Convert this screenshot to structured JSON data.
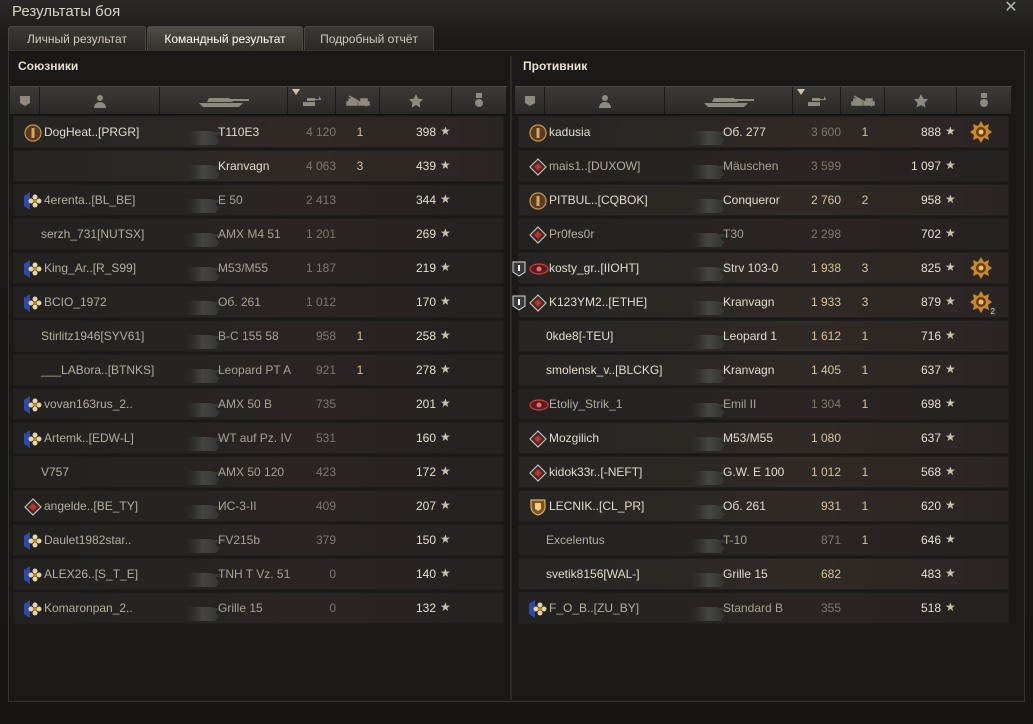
{
  "window": {
    "title": "Результаты боя",
    "close": "✕"
  },
  "tabs": [
    "Личный результат",
    "Командный результат",
    "Подробный отчёт"
  ],
  "active_tab": 1,
  "allies": {
    "title": "Союзники",
    "rows": [
      {
        "name": "DogHeat..[PRGR]",
        "tank": "T110E3",
        "damage": "4 120",
        "kills": "1",
        "xp": "398",
        "badge": "rank-gold",
        "alive": true,
        "dmg_hi": false
      },
      {
        "name": "",
        "tank": "Kranvagn",
        "damage": "4 063",
        "kills": "3",
        "xp": "439",
        "badge": "none",
        "alive": true,
        "dmg_hi": false
      },
      {
        "name": "4erenta..[BL_BE]",
        "tank": "E 50",
        "damage": "2 413",
        "kills": "",
        "xp": "344",
        "badge": "flower",
        "alive": false,
        "dmg_hi": false
      },
      {
        "name": "serzh_731[NUTSX]",
        "tank": "AMX M4 51",
        "damage": "1 201",
        "kills": "",
        "xp": "269",
        "badge": "none",
        "alive": false,
        "dmg_hi": false
      },
      {
        "name": "King_Ar..[R_S99]",
        "tank": "M53/M55",
        "damage": "1 187",
        "kills": "",
        "xp": "219",
        "badge": "flower",
        "alive": false,
        "dmg_hi": false
      },
      {
        "name": "BCIO_1972",
        "tank": "Об. 261",
        "damage": "1 012",
        "kills": "",
        "xp": "170",
        "badge": "flower",
        "alive": false,
        "dmg_hi": false
      },
      {
        "name": "Stirlitz1946[SYV61]",
        "tank": "В-С 155 58",
        "damage": "958",
        "kills": "1",
        "xp": "258",
        "badge": "none",
        "alive": false,
        "dmg_hi": false
      },
      {
        "name": "___LABora..[BTNKS]",
        "tank": "Leopard PT A",
        "damage": "921",
        "kills": "1",
        "xp": "278",
        "badge": "none",
        "alive": false,
        "dmg_hi": false
      },
      {
        "name": "vovan163rus_2..",
        "tank": "AMX 50 B",
        "damage": "735",
        "kills": "",
        "xp": "201",
        "badge": "flower",
        "alive": false,
        "dmg_hi": false
      },
      {
        "name": "Artemk..[EDW-L]",
        "tank": "WT auf Pz. IV",
        "damage": "531",
        "kills": "",
        "xp": "160",
        "badge": "flower",
        "alive": false,
        "dmg_hi": false
      },
      {
        "name": "V757",
        "tank": "AMX 50 120",
        "damage": "423",
        "kills": "",
        "xp": "172",
        "badge": "none",
        "alive": false,
        "dmg_hi": false
      },
      {
        "name": "angelde..[BE_TY]",
        "tank": "ИС-3-II",
        "damage": "409",
        "kills": "",
        "xp": "207",
        "badge": "diamond",
        "alive": false,
        "dmg_hi": false
      },
      {
        "name": "Daulet1982star..",
        "tank": "FV215b",
        "damage": "379",
        "kills": "",
        "xp": "150",
        "badge": "flower",
        "alive": false,
        "dmg_hi": false
      },
      {
        "name": "ALEX26..[S_T_E]",
        "tank": "TNH T Vz. 51",
        "damage": "0",
        "kills": "",
        "xp": "140",
        "badge": "flower",
        "alive": false,
        "dmg_hi": false
      },
      {
        "name": "Komaronpan_2..",
        "tank": "Grille 15",
        "damage": "0",
        "kills": "",
        "xp": "132",
        "badge": "flower",
        "alive": false,
        "dmg_hi": false
      }
    ]
  },
  "enemies": {
    "title": "Противник",
    "rows": [
      {
        "name": "kadusia",
        "tank": "Об. 277",
        "damage": "3 600",
        "kills": "1",
        "xp": "888",
        "badge": "rank-gold",
        "alive": true,
        "dmg_hi": false,
        "medal": "gold"
      },
      {
        "name": "mais1..[DUXOW]",
        "tank": "Mäuschen",
        "damage": "3 599",
        "kills": "",
        "xp": "1 097",
        "badge": "diamond",
        "alive": false,
        "dmg_hi": false
      },
      {
        "name": "PITBUL..[CQBOK]",
        "tank": "Conqueror",
        "damage": "2 760",
        "kills": "2",
        "xp": "958",
        "badge": "rank-gold",
        "alive": true,
        "dmg_hi": true
      },
      {
        "name": "Pr0fes0r",
        "tank": "T30",
        "damage": "2 298",
        "kills": "",
        "xp": "702",
        "badge": "diamond",
        "alive": false,
        "dmg_hi": false
      },
      {
        "name": "kosty_gr..[IIOHT]",
        "tank": "Strv 103-0",
        "damage": "1 938",
        "kills": "3",
        "xp": "825",
        "badge": "eye",
        "alive": true,
        "dmg_hi": true,
        "flag": true,
        "medal": "gold"
      },
      {
        "name": "K123YM2..[ETHE]",
        "tank": "Kranvagn",
        "damage": "1 933",
        "kills": "3",
        "xp": "879",
        "badge": "diamond",
        "alive": true,
        "dmg_hi": true,
        "flag": true,
        "medal": "gold",
        "medal_count": "2"
      },
      {
        "name": "0kde8[-TEU]",
        "tank": "Leopard 1",
        "damage": "1 612",
        "kills": "1",
        "xp": "716",
        "badge": "none",
        "alive": true,
        "dmg_hi": true
      },
      {
        "name": "smolensk_v..[BLCKG]",
        "tank": "Kranvagn",
        "damage": "1 405",
        "kills": "1",
        "xp": "637",
        "badge": "none",
        "alive": true,
        "dmg_hi": true
      },
      {
        "name": "Etoliy_Strik_1",
        "tank": "Emil II",
        "damage": "1 304",
        "kills": "1",
        "xp": "698",
        "badge": "eye",
        "alive": false,
        "dmg_hi": false
      },
      {
        "name": "Mozgilich",
        "tank": "M53/M55",
        "damage": "1 080",
        "kills": "",
        "xp": "637",
        "badge": "diamond",
        "alive": true,
        "dmg_hi": true
      },
      {
        "name": "kidok33r..[-NEFT]",
        "tank": "G.W. E 100",
        "damage": "1 012",
        "kills": "1",
        "xp": "568",
        "badge": "diamond",
        "alive": true,
        "dmg_hi": true
      },
      {
        "name": "LECNIK..[CL_PR]",
        "tank": "Об. 261",
        "damage": "931",
        "kills": "1",
        "xp": "620",
        "badge": "shield",
        "alive": true,
        "dmg_hi": true
      },
      {
        "name": "Excelentus",
        "tank": "T-10",
        "damage": "871",
        "kills": "1",
        "xp": "646",
        "badge": "none",
        "alive": false,
        "dmg_hi": false
      },
      {
        "name": "svetik8156[WAL-]",
        "tank": "Grille 15",
        "damage": "682",
        "kills": "",
        "xp": "483",
        "badge": "none",
        "alive": true,
        "dmg_hi": true
      },
      {
        "name": "F_O_B..[ZU_BY]",
        "tank": "Standard B",
        "damage": "355",
        "kills": "",
        "xp": "518",
        "badge": "flower",
        "alive": false,
        "dmg_hi": false
      }
    ]
  },
  "star_glyph": "★",
  "colors": {
    "accent": "#d8c49a",
    "text": "#e2dccd",
    "muted": "#7e796f"
  }
}
